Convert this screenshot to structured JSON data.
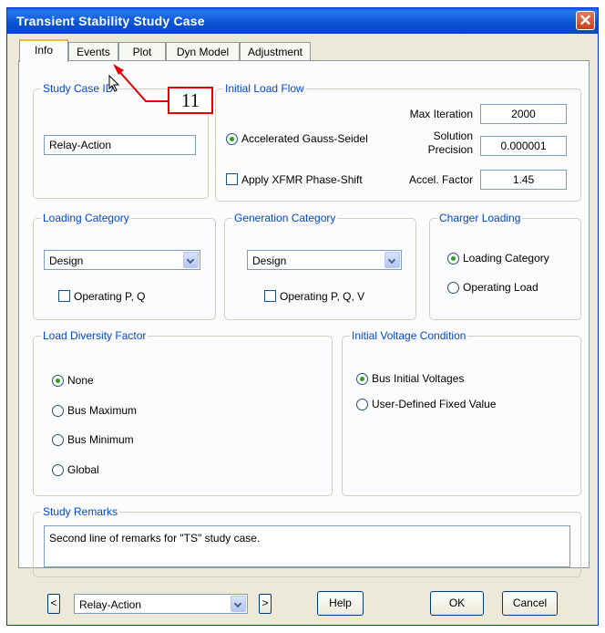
{
  "window": {
    "title": "Transient Stability Study Case",
    "close_symbol": "✕"
  },
  "tabs": [
    {
      "label": "Info",
      "active": true
    },
    {
      "label": "Events",
      "active": false
    },
    {
      "label": "Plot",
      "active": false
    },
    {
      "label": "Dyn Model",
      "active": false
    },
    {
      "label": "Adjustment",
      "active": false
    }
  ],
  "annotation": {
    "number": "11",
    "color": "#e00000"
  },
  "study_case_id": {
    "label": "Study Case ID",
    "value": "Relay-Action"
  },
  "initial_load_flow": {
    "label": "Initial Load Flow",
    "method": "Accelerated Gauss-Seidel",
    "apply_xfmr": "Apply XFMR Phase-Shift",
    "max_iteration_label": "Max Iteration",
    "max_iteration_value": "2000",
    "solution_precision_label_line1": "Solution",
    "solution_precision_label_line2": "Precision",
    "solution_precision_value": "0.000001",
    "accel_factor_label": "Accel. Factor",
    "accel_factor_value": "1.45"
  },
  "loading_category": {
    "label": "Loading Category",
    "selected": "Design",
    "operating": "Operating P, Q"
  },
  "generation_category": {
    "label": "Generation Category",
    "selected": "Design",
    "operating": "Operating P, Q, V"
  },
  "charger_loading": {
    "label": "Charger Loading",
    "opt1": "Loading Category",
    "opt2": "Operating Load"
  },
  "load_diversity": {
    "label": "Load Diversity Factor",
    "opt_none": "None",
    "opt_max": "Bus Maximum",
    "opt_min": "Bus Minimum",
    "opt_global": "Global"
  },
  "initial_voltage": {
    "label": "Initial Voltage Condition",
    "opt1": "Bus Initial Voltages",
    "opt2": "User-Defined Fixed Value"
  },
  "study_remarks": {
    "label": "Study Remarks",
    "text": "Second line of remarks for \"TS\" study case."
  },
  "footer": {
    "prev_symbol": "<",
    "next_symbol": ">",
    "study_case_select": "Relay-Action",
    "help_label": "Help",
    "ok_label": "OK",
    "cancel_label": "Cancel"
  },
  "colors": {
    "titlebar": "#0b55d4",
    "group_label": "#0046d5",
    "dialog_bg": "#ece9d8",
    "radio_selected": "#2aa11a"
  }
}
